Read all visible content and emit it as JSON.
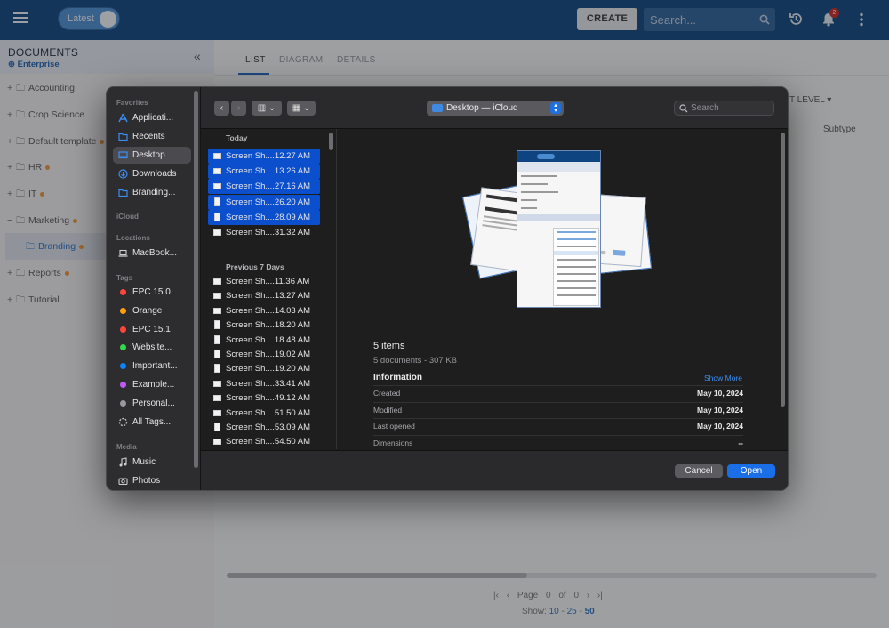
{
  "topbar": {
    "latest_label": "Latest",
    "create_label": "CREATE",
    "search_placeholder": "Search...",
    "notification_count": "2"
  },
  "tree": {
    "title": "DOCUMENTS",
    "subtitle": "Enterprise",
    "items": [
      {
        "label": "Accounting",
        "toggle": "+",
        "dot": false
      },
      {
        "label": "Crop Science",
        "toggle": "+",
        "dot": false
      },
      {
        "label": "Default template",
        "toggle": "+",
        "dot": true
      },
      {
        "label": "HR",
        "toggle": "+",
        "dot": true
      },
      {
        "label": "IT",
        "toggle": "+",
        "dot": true
      },
      {
        "label": "Marketing",
        "toggle": "−",
        "dot": true
      },
      {
        "label": "Branding",
        "toggle": "",
        "dot": true
      },
      {
        "label": "Reports",
        "toggle": "+",
        "dot": true
      },
      {
        "label": "Tutorial",
        "toggle": "+",
        "dot": false
      }
    ]
  },
  "main": {
    "tabs": [
      "LIST",
      "DIAGRAM",
      "DETAILS"
    ],
    "level_label": "T LEVEL",
    "subtype_header": "Subtype",
    "pager_page": "Page",
    "pager_current": "0",
    "pager_of": "of",
    "pager_total": "0",
    "show_label": "Show:",
    "show_options": [
      "10",
      "25",
      "50"
    ]
  },
  "dialog": {
    "sidebar": {
      "favorites_label": "Favorites",
      "favorites": [
        "Applicati...",
        "Recents",
        "Desktop",
        "Downloads",
        "Branding..."
      ],
      "icloud_label": "iCloud",
      "locations_label": "Locations",
      "locations": [
        "MacBook..."
      ],
      "tags_label": "Tags",
      "tags": [
        {
          "label": "EPC 15.0",
          "color": "#ff453a"
        },
        {
          "label": "Orange",
          "color": "#ff9f0a"
        },
        {
          "label": "EPC 15.1",
          "color": "#ff453a"
        },
        {
          "label": "Website...",
          "color": "#32d74b"
        },
        {
          "label": "Important...",
          "color": "#0a84ff"
        },
        {
          "label": "Example...",
          "color": "#bf5af2"
        },
        {
          "label": "Personal...",
          "color": "#98989d"
        },
        {
          "label": "All Tags...",
          "color": ""
        }
      ],
      "media_label": "Media",
      "media": [
        "Music",
        "Photos"
      ]
    },
    "toolbar": {
      "location": "Desktop — iCloud",
      "search_placeholder": "Search"
    },
    "files": {
      "today_label": "Today",
      "today": [
        {
          "name": "Screen Sh....12.27 AM",
          "selected": true
        },
        {
          "name": "Screen Sh....13.26 AM",
          "selected": true
        },
        {
          "name": "Screen Sh....27.16 AM",
          "selected": true
        },
        {
          "name": "Screen Sh....26.20 AM",
          "selected": true
        },
        {
          "name": "Screen Sh....28.09 AM",
          "selected": true
        },
        {
          "name": "Screen Sh....31.32 AM",
          "selected": false
        }
      ],
      "week_label": "Previous 7 Days",
      "week": [
        "Screen Sh....11.36 AM",
        "Screen Sh....13.27 AM",
        "Screen Sh....14.03 AM",
        "Screen Sh....18.20 AM",
        "Screen Sh....18.48 AM",
        "Screen Sh....19.02 AM",
        "Screen Sh....19.20 AM",
        "Screen Sh....33.41 AM",
        "Screen Sh....49.12 AM",
        "Screen Sh....51.50 AM",
        "Screen Sh....53.09 AM",
        "Screen Sh....54.50 AM"
      ]
    },
    "preview": {
      "items_count": "5 items",
      "items_detail": "5 documents - 307 KB",
      "info_title": "Information",
      "show_more": "Show More",
      "rows": [
        {
          "label": "Created",
          "value": "May 10, 2024"
        },
        {
          "label": "Modified",
          "value": "May 10, 2024"
        },
        {
          "label": "Last opened",
          "value": "May 10, 2024"
        },
        {
          "label": "Dimensions",
          "value": "--"
        }
      ]
    },
    "buttons": {
      "cancel": "Cancel",
      "open": "Open"
    }
  }
}
